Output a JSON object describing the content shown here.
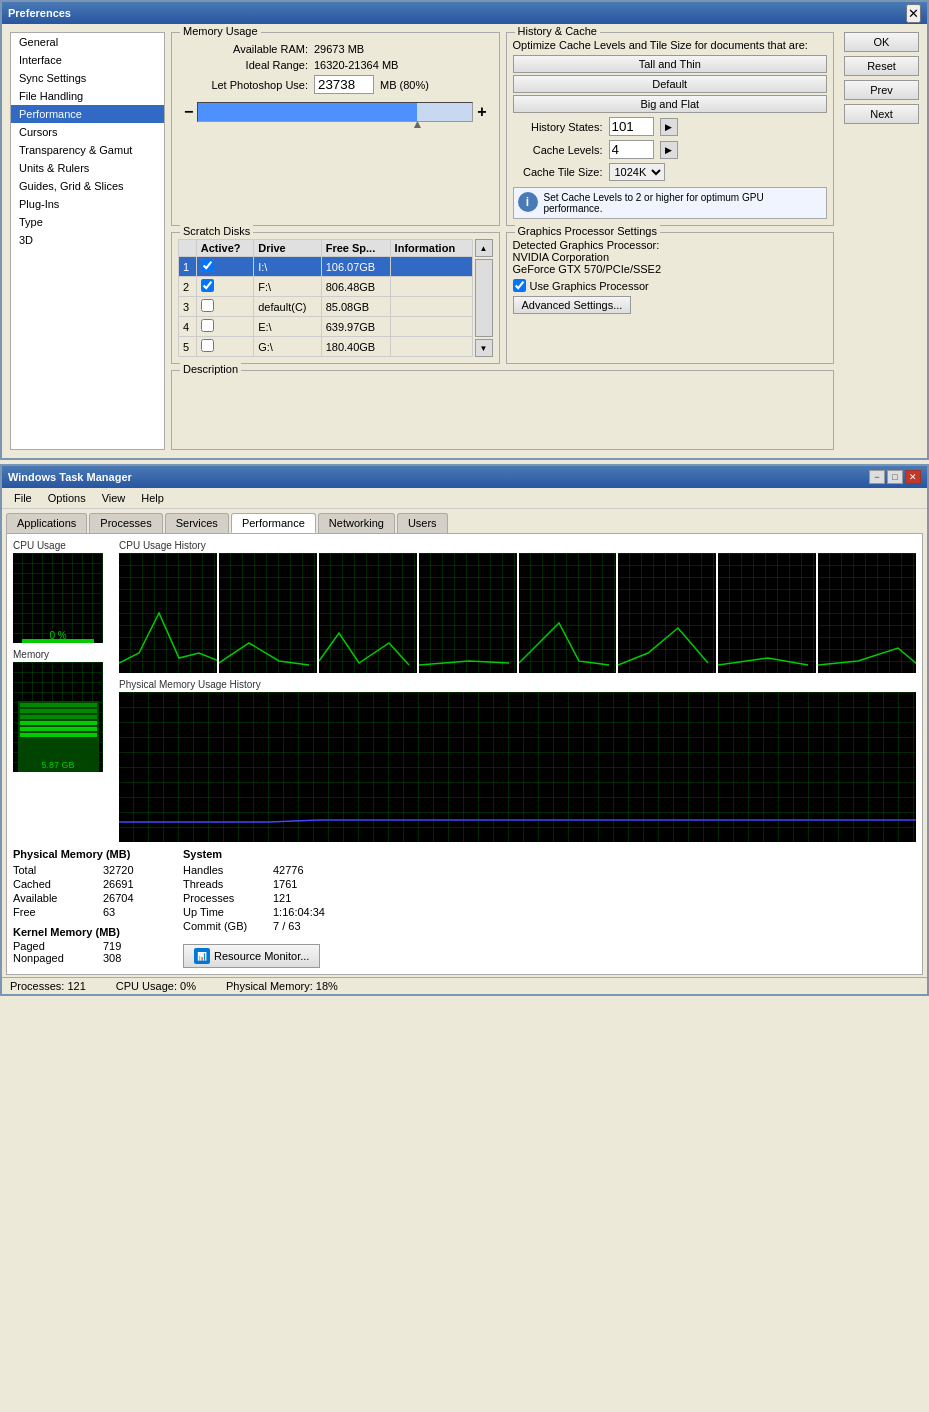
{
  "preferences": {
    "title": "Preferences",
    "sidebar": {
      "items": [
        {
          "label": "General",
          "active": false
        },
        {
          "label": "Interface",
          "active": false
        },
        {
          "label": "Sync Settings",
          "active": false
        },
        {
          "label": "File Handling",
          "active": false
        },
        {
          "label": "Performance",
          "active": true
        },
        {
          "label": "Cursors",
          "active": false
        },
        {
          "label": "Transparency & Gamut",
          "active": false
        },
        {
          "label": "Units & Rulers",
          "active": false
        },
        {
          "label": "Guides, Grid & Slices",
          "active": false
        },
        {
          "label": "Plug-Ins",
          "active": false
        },
        {
          "label": "Type",
          "active": false
        },
        {
          "label": "3D",
          "active": false
        }
      ]
    },
    "buttons": {
      "ok": "OK",
      "reset": "Reset",
      "prev": "Prev",
      "next": "Next"
    },
    "memory": {
      "group_title": "Memory Usage",
      "available_ram_label": "Available RAM:",
      "available_ram_value": "29673 MB",
      "ideal_range_label": "Ideal Range:",
      "ideal_range_value": "16320-21364 MB",
      "let_ps_use_label": "Let Photoshop Use:",
      "let_ps_use_value": "23738",
      "let_ps_use_unit": "MB (80%)"
    },
    "history_cache": {
      "group_title": "History & Cache",
      "optimize_text": "Optimize Cache Levels and Tile Size for documents that are:",
      "btn_tall_thin": "Tall and Thin",
      "btn_default": "Default",
      "btn_big_flat": "Big and Flat",
      "history_states_label": "History States:",
      "history_states_value": "101",
      "cache_levels_label": "Cache Levels:",
      "cache_levels_value": "4",
      "cache_tile_label": "Cache Tile Size:",
      "cache_tile_value": "1024K",
      "info_text": "Set Cache Levels to 2 or higher for optimum GPU performance."
    },
    "scratch_disks": {
      "group_title": "Scratch Disks",
      "columns": [
        "Active?",
        "Drive",
        "Free Sp...",
        "Information"
      ],
      "rows": [
        {
          "num": "1",
          "active": true,
          "drive": "I:\\",
          "free": "106.07GB",
          "info": "",
          "selected": true
        },
        {
          "num": "2",
          "active": true,
          "drive": "F:\\",
          "free": "806.48GB",
          "info": "",
          "selected": false
        },
        {
          "num": "3",
          "active": false,
          "drive": "default(C)",
          "free": "85.08GB",
          "info": "",
          "selected": false
        },
        {
          "num": "4",
          "active": false,
          "drive": "E:\\",
          "free": "639.97GB",
          "info": "",
          "selected": false
        },
        {
          "num": "5",
          "active": false,
          "drive": "G:\\",
          "free": "180.40GB",
          "info": "",
          "selected": false
        }
      ]
    },
    "gpu": {
      "group_title": "Graphics Processor Settings",
      "detected_label": "Detected Graphics Processor:",
      "gpu_name": "NVIDIA Corporation",
      "gpu_model": "GeForce GTX 570/PCIe/SSE2",
      "use_gpu_label": "Use Graphics Processor",
      "advanced_btn": "Advanced Settings..."
    },
    "description": {
      "group_title": "Description"
    }
  },
  "task_manager": {
    "title": "Windows Task Manager",
    "menu": {
      "file": "File",
      "options": "Options",
      "view": "View",
      "help": "Help"
    },
    "tabs": [
      {
        "label": "Applications",
        "active": false
      },
      {
        "label": "Processes",
        "active": false
      },
      {
        "label": "Services",
        "active": false
      },
      {
        "label": "Performance",
        "active": true
      },
      {
        "label": "Networking",
        "active": false
      },
      {
        "label": "Users",
        "active": false
      }
    ],
    "cpu_usage": {
      "title": "CPU Usage",
      "value": "0 %"
    },
    "cpu_history": {
      "title": "CPU Usage History"
    },
    "memory_title": "Memory",
    "memory_value": "5.87 GB",
    "physical_memory_history": {
      "title": "Physical Memory Usage History"
    },
    "physical_memory": {
      "title": "Physical Memory (MB)",
      "total_label": "Total",
      "total_value": "32720",
      "cached_label": "Cached",
      "cached_value": "26691",
      "available_label": "Available",
      "available_value": "26704",
      "free_label": "Free",
      "free_value": "63"
    },
    "system": {
      "title": "System",
      "handles_label": "Handles",
      "handles_value": "42776",
      "threads_label": "Threads",
      "threads_value": "1761",
      "processes_label": "Processes",
      "processes_value": "121",
      "uptime_label": "Up Time",
      "uptime_value": "1:16:04:34",
      "commit_label": "Commit (GB)",
      "commit_value": "7 / 63"
    },
    "kernel_memory": {
      "title": "Kernel Memory (MB)",
      "paged_label": "Paged",
      "paged_value": "719",
      "nonpaged_label": "Nonpaged",
      "nonpaged_value": "308"
    },
    "resource_btn": "Resource Monitor...",
    "status_bar": {
      "processes_label": "Processes: 121",
      "cpu_label": "CPU Usage: 0%",
      "memory_label": "Physical Memory: 18%"
    }
  }
}
